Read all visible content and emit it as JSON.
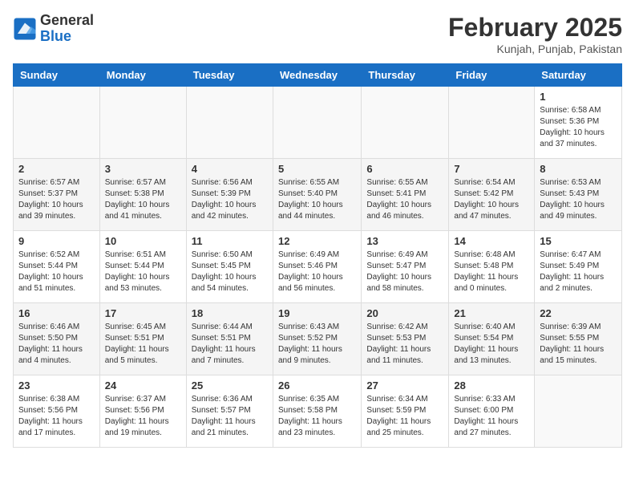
{
  "logo": {
    "general": "General",
    "blue": "Blue"
  },
  "title": "February 2025",
  "location": "Kunjah, Punjab, Pakistan",
  "weekdays": [
    "Sunday",
    "Monday",
    "Tuesday",
    "Wednesday",
    "Thursday",
    "Friday",
    "Saturday"
  ],
  "weeks": [
    [
      {
        "day": "",
        "info": ""
      },
      {
        "day": "",
        "info": ""
      },
      {
        "day": "",
        "info": ""
      },
      {
        "day": "",
        "info": ""
      },
      {
        "day": "",
        "info": ""
      },
      {
        "day": "",
        "info": ""
      },
      {
        "day": "1",
        "info": "Sunrise: 6:58 AM\nSunset: 5:36 PM\nDaylight: 10 hours\nand 37 minutes."
      }
    ],
    [
      {
        "day": "2",
        "info": "Sunrise: 6:57 AM\nSunset: 5:37 PM\nDaylight: 10 hours\nand 39 minutes."
      },
      {
        "day": "3",
        "info": "Sunrise: 6:57 AM\nSunset: 5:38 PM\nDaylight: 10 hours\nand 41 minutes."
      },
      {
        "day": "4",
        "info": "Sunrise: 6:56 AM\nSunset: 5:39 PM\nDaylight: 10 hours\nand 42 minutes."
      },
      {
        "day": "5",
        "info": "Sunrise: 6:55 AM\nSunset: 5:40 PM\nDaylight: 10 hours\nand 44 minutes."
      },
      {
        "day": "6",
        "info": "Sunrise: 6:55 AM\nSunset: 5:41 PM\nDaylight: 10 hours\nand 46 minutes."
      },
      {
        "day": "7",
        "info": "Sunrise: 6:54 AM\nSunset: 5:42 PM\nDaylight: 10 hours\nand 47 minutes."
      },
      {
        "day": "8",
        "info": "Sunrise: 6:53 AM\nSunset: 5:43 PM\nDaylight: 10 hours\nand 49 minutes."
      }
    ],
    [
      {
        "day": "9",
        "info": "Sunrise: 6:52 AM\nSunset: 5:44 PM\nDaylight: 10 hours\nand 51 minutes."
      },
      {
        "day": "10",
        "info": "Sunrise: 6:51 AM\nSunset: 5:44 PM\nDaylight: 10 hours\nand 53 minutes."
      },
      {
        "day": "11",
        "info": "Sunrise: 6:50 AM\nSunset: 5:45 PM\nDaylight: 10 hours\nand 54 minutes."
      },
      {
        "day": "12",
        "info": "Sunrise: 6:49 AM\nSunset: 5:46 PM\nDaylight: 10 hours\nand 56 minutes."
      },
      {
        "day": "13",
        "info": "Sunrise: 6:49 AM\nSunset: 5:47 PM\nDaylight: 10 hours\nand 58 minutes."
      },
      {
        "day": "14",
        "info": "Sunrise: 6:48 AM\nSunset: 5:48 PM\nDaylight: 11 hours\nand 0 minutes."
      },
      {
        "day": "15",
        "info": "Sunrise: 6:47 AM\nSunset: 5:49 PM\nDaylight: 11 hours\nand 2 minutes."
      }
    ],
    [
      {
        "day": "16",
        "info": "Sunrise: 6:46 AM\nSunset: 5:50 PM\nDaylight: 11 hours\nand 4 minutes."
      },
      {
        "day": "17",
        "info": "Sunrise: 6:45 AM\nSunset: 5:51 PM\nDaylight: 11 hours\nand 5 minutes."
      },
      {
        "day": "18",
        "info": "Sunrise: 6:44 AM\nSunset: 5:51 PM\nDaylight: 11 hours\nand 7 minutes."
      },
      {
        "day": "19",
        "info": "Sunrise: 6:43 AM\nSunset: 5:52 PM\nDaylight: 11 hours\nand 9 minutes."
      },
      {
        "day": "20",
        "info": "Sunrise: 6:42 AM\nSunset: 5:53 PM\nDaylight: 11 hours\nand 11 minutes."
      },
      {
        "day": "21",
        "info": "Sunrise: 6:40 AM\nSunset: 5:54 PM\nDaylight: 11 hours\nand 13 minutes."
      },
      {
        "day": "22",
        "info": "Sunrise: 6:39 AM\nSunset: 5:55 PM\nDaylight: 11 hours\nand 15 minutes."
      }
    ],
    [
      {
        "day": "23",
        "info": "Sunrise: 6:38 AM\nSunset: 5:56 PM\nDaylight: 11 hours\nand 17 minutes."
      },
      {
        "day": "24",
        "info": "Sunrise: 6:37 AM\nSunset: 5:56 PM\nDaylight: 11 hours\nand 19 minutes."
      },
      {
        "day": "25",
        "info": "Sunrise: 6:36 AM\nSunset: 5:57 PM\nDaylight: 11 hours\nand 21 minutes."
      },
      {
        "day": "26",
        "info": "Sunrise: 6:35 AM\nSunset: 5:58 PM\nDaylight: 11 hours\nand 23 minutes."
      },
      {
        "day": "27",
        "info": "Sunrise: 6:34 AM\nSunset: 5:59 PM\nDaylight: 11 hours\nand 25 minutes."
      },
      {
        "day": "28",
        "info": "Sunrise: 6:33 AM\nSunset: 6:00 PM\nDaylight: 11 hours\nand 27 minutes."
      },
      {
        "day": "",
        "info": ""
      }
    ]
  ]
}
